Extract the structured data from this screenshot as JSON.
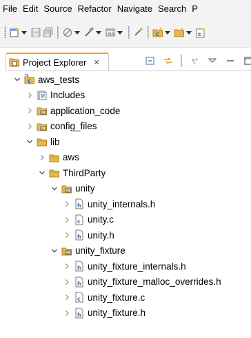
{
  "menubar": {
    "items": [
      "File",
      "Edit",
      "Source",
      "Refactor",
      "Navigate",
      "Search",
      "P"
    ]
  },
  "toolbar": {
    "icons": [
      "new-wizard-icon",
      "save-icon",
      "save-all-icon",
      "skip-breakpoints-icon",
      "build-icon",
      "debug-icon",
      "terminal-icon",
      "new-c-project-icon",
      "new-folder-icon",
      "new-class-icon"
    ]
  },
  "project_explorer": {
    "tab_label": "Project Explorer",
    "close_glyph": "✕"
  },
  "tree": {
    "nodes": [
      {
        "label": "aws_tests",
        "depth": 0,
        "expanded": true,
        "kind": "project"
      },
      {
        "label": "Includes",
        "depth": 1,
        "expanded": false,
        "kind": "includes"
      },
      {
        "label": "application_code",
        "depth": 1,
        "expanded": false,
        "kind": "source-folder"
      },
      {
        "label": "config_files",
        "depth": 1,
        "expanded": false,
        "kind": "source-folder"
      },
      {
        "label": "lib",
        "depth": 1,
        "expanded": true,
        "kind": "folder"
      },
      {
        "label": "aws",
        "depth": 2,
        "expanded": false,
        "kind": "folder"
      },
      {
        "label": "ThirdParty",
        "depth": 2,
        "expanded": true,
        "kind": "folder"
      },
      {
        "label": "unity",
        "depth": 3,
        "expanded": true,
        "kind": "source-folder"
      },
      {
        "label": "unity_internals.h",
        "depth": 4,
        "expanded": false,
        "kind": "header"
      },
      {
        "label": "unity.c",
        "depth": 4,
        "expanded": false,
        "kind": "c-source"
      },
      {
        "label": "unity.h",
        "depth": 4,
        "expanded": false,
        "kind": "header"
      },
      {
        "label": "unity_fixture",
        "depth": 3,
        "expanded": true,
        "kind": "source-folder"
      },
      {
        "label": "unity_fixture_internals.h",
        "depth": 4,
        "expanded": false,
        "kind": "header"
      },
      {
        "label": "unity_fixture_malloc_overrides.h",
        "depth": 4,
        "expanded": false,
        "kind": "header"
      },
      {
        "label": "unity_fixture.c",
        "depth": 4,
        "expanded": false,
        "kind": "c-source"
      },
      {
        "label": "unity_fixture.h",
        "depth": 4,
        "expanded": false,
        "kind": "header"
      }
    ]
  },
  "colors": {
    "menubar_bg": "#f3f3f3",
    "active_tab_accent": "#f0a030",
    "folder": "#d9a441",
    "header_icon": "#3b6fb5",
    "c_source_icon": "#3b6fb5"
  }
}
